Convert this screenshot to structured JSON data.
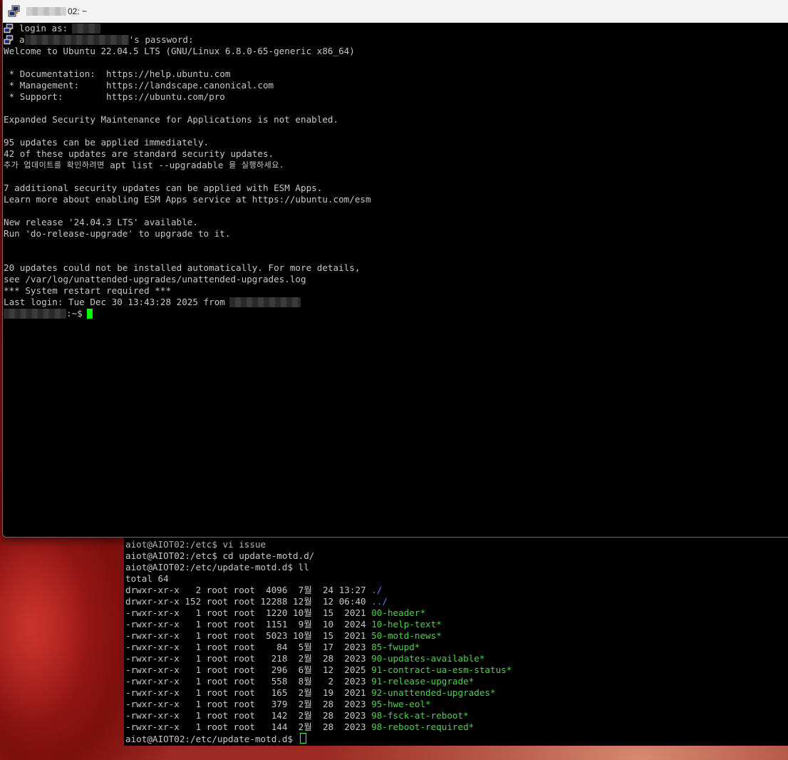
{
  "window": {
    "title_suffix": "02: ~"
  },
  "login": {
    "prompt": "login as:",
    "user_prefix": "a",
    "password_suffix": "'s password:"
  },
  "motd": {
    "welcome": "Welcome to Ubuntu 22.04.5 LTS (GNU/Linux 6.8.0-65-generic x86_64)",
    "doc": " * Documentation:  https://help.ubuntu.com",
    "mgmt": " * Management:     https://landscape.canonical.com",
    "support": " * Support:        https://ubuntu.com/pro",
    "esm": "Expanded Security Maintenance for Applications is not enabled.",
    "updates1": "95 updates can be applied immediately.",
    "updates2": "42 of these updates are standard security updates.",
    "updates3_kr_a": "추가 업데이트를 확인하려면",
    "updates3_cmd": " apt list --upgradable ",
    "updates3_kr_b": "을 실행하세요.",
    "esm_apps1": "7 additional security updates can be applied with ESM Apps.",
    "esm_apps2": "Learn more about enabling ESM Apps service at https://ubuntu.com/esm",
    "release1": "New release '24.04.3 LTS' available.",
    "release2": "Run 'do-release-upgrade' to upgrade to it.",
    "unattended1": "20 updates could not be installed automatically. For more details,",
    "unattended2": "see /var/log/unattended-upgrades/unattended-upgrades.log",
    "restart": "*** System restart required ***",
    "last_login": "Last login: Tue Dec 30 13:43:28 2025 from",
    "prompt_suffix": ":~$"
  },
  "back": {
    "cmd1": "aiot@AIOT02:/etc$ vi issue",
    "cmd2": "aiot@AIOT02:/etc$ cd update-motd.d/",
    "cmd3": "aiot@AIOT02:/etc/update-motd.d$ ll",
    "total": "total 64",
    "rows": [
      {
        "cols": "drwxr-xr-x   2 root root  4096  7월  24 13:27 ",
        "name": "./",
        "kind": "dir"
      },
      {
        "cols": "drwxr-xr-x 152 root root 12288 12월  12 06:40 ",
        "name": "../",
        "kind": "dir"
      },
      {
        "cols": "-rwxr-xr-x   1 root root  1220 10월  15  2021 ",
        "name": "00-header*",
        "kind": "exec"
      },
      {
        "cols": "-rwxr-xr-x   1 root root  1151  9월  10  2024 ",
        "name": "10-help-text*",
        "kind": "exec"
      },
      {
        "cols": "-rwxr-xr-x   1 root root  5023 10월  15  2021 ",
        "name": "50-motd-news*",
        "kind": "exec"
      },
      {
        "cols": "-rwxr-xr-x   1 root root    84  5월  17  2023 ",
        "name": "85-fwupd*",
        "kind": "exec"
      },
      {
        "cols": "-rwxr-xr-x   1 root root   218  2월  28  2023 ",
        "name": "90-updates-available*",
        "kind": "exec"
      },
      {
        "cols": "-rwxr-xr-x   1 root root   296  6월  12  2025 ",
        "name": "91-contract-ua-esm-status*",
        "kind": "exec"
      },
      {
        "cols": "-rwxr-xr-x   1 root root   558  8월   2  2023 ",
        "name": "91-release-upgrade*",
        "kind": "exec"
      },
      {
        "cols": "-rwxr-xr-x   1 root root   165  2월  19  2021 ",
        "name": "92-unattended-upgrades*",
        "kind": "exec"
      },
      {
        "cols": "-rwxr-xr-x   1 root root   379  2월  28  2023 ",
        "name": "95-hwe-eol*",
        "kind": "exec"
      },
      {
        "cols": "-rwxr-xr-x   1 root root   142  2월  28  2023 ",
        "name": "98-fsck-at-reboot*",
        "kind": "exec"
      },
      {
        "cols": "-rwxr-xr-x   1 root root   144  2월  28  2023 ",
        "name": "98-reboot-required*",
        "kind": "exec"
      }
    ],
    "final_prompt": "aiot@AIOT02:/etc/update-motd.d$"
  },
  "colors": {
    "dir": "#5c7cfa",
    "exec": "#4cd04c",
    "cursor": "#00ff00"
  }
}
